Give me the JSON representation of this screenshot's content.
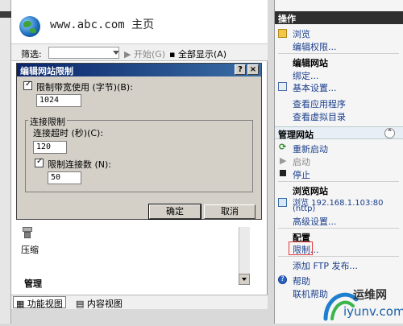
{
  "main": {
    "page_title": "www.abc.com 主页",
    "filter": {
      "label": "筛选:",
      "value": ""
    },
    "toolbar": {
      "start": "开始(G)",
      "show_all": "全部显示(A)"
    }
  },
  "dialog": {
    "title": "编辑网站限制",
    "help": "?",
    "close": "×",
    "limit_bandwidth_label": "限制带宽使用 (字节)(B):",
    "bandwidth_value": "1024",
    "group_title": "连接限制",
    "timeout_label": "连接超时 (秒)(C):",
    "timeout_value": "120",
    "limit_connections_label": "限制连接数 (N):",
    "connections_value": "50",
    "ok": "确定",
    "cancel": "取消"
  },
  "feature": {
    "compress_label": "压缩",
    "manage_section": "管理"
  },
  "bottom_tabs": {
    "features_view": "功能视图",
    "content_view": "内容视图"
  },
  "actions": {
    "header": "操作",
    "browse": "浏览",
    "edit_permissions": "编辑权限...",
    "edit_site_header": "编辑网站",
    "bindings": "绑定...",
    "basic_settings": "基本设置...",
    "view_apps": "查看应用程序",
    "view_vdirs": "查看虚拟目录",
    "manage_site_header": "管理网站",
    "restart": "重新启动",
    "start": "启动",
    "stop": "停止",
    "browse_site_header": "浏览网站",
    "browse_address": "浏览 192.168.1.103:80",
    "browse_address2": "(http)",
    "advanced_settings": "高级设置...",
    "config_header": "配置",
    "limits": "限制...",
    "add_ftp": "添加 FTP 发布...",
    "help": "帮助",
    "online_help": "联机帮助"
  },
  "watermark": {
    "text1": "运维网",
    "text2": "iyunv.com"
  }
}
